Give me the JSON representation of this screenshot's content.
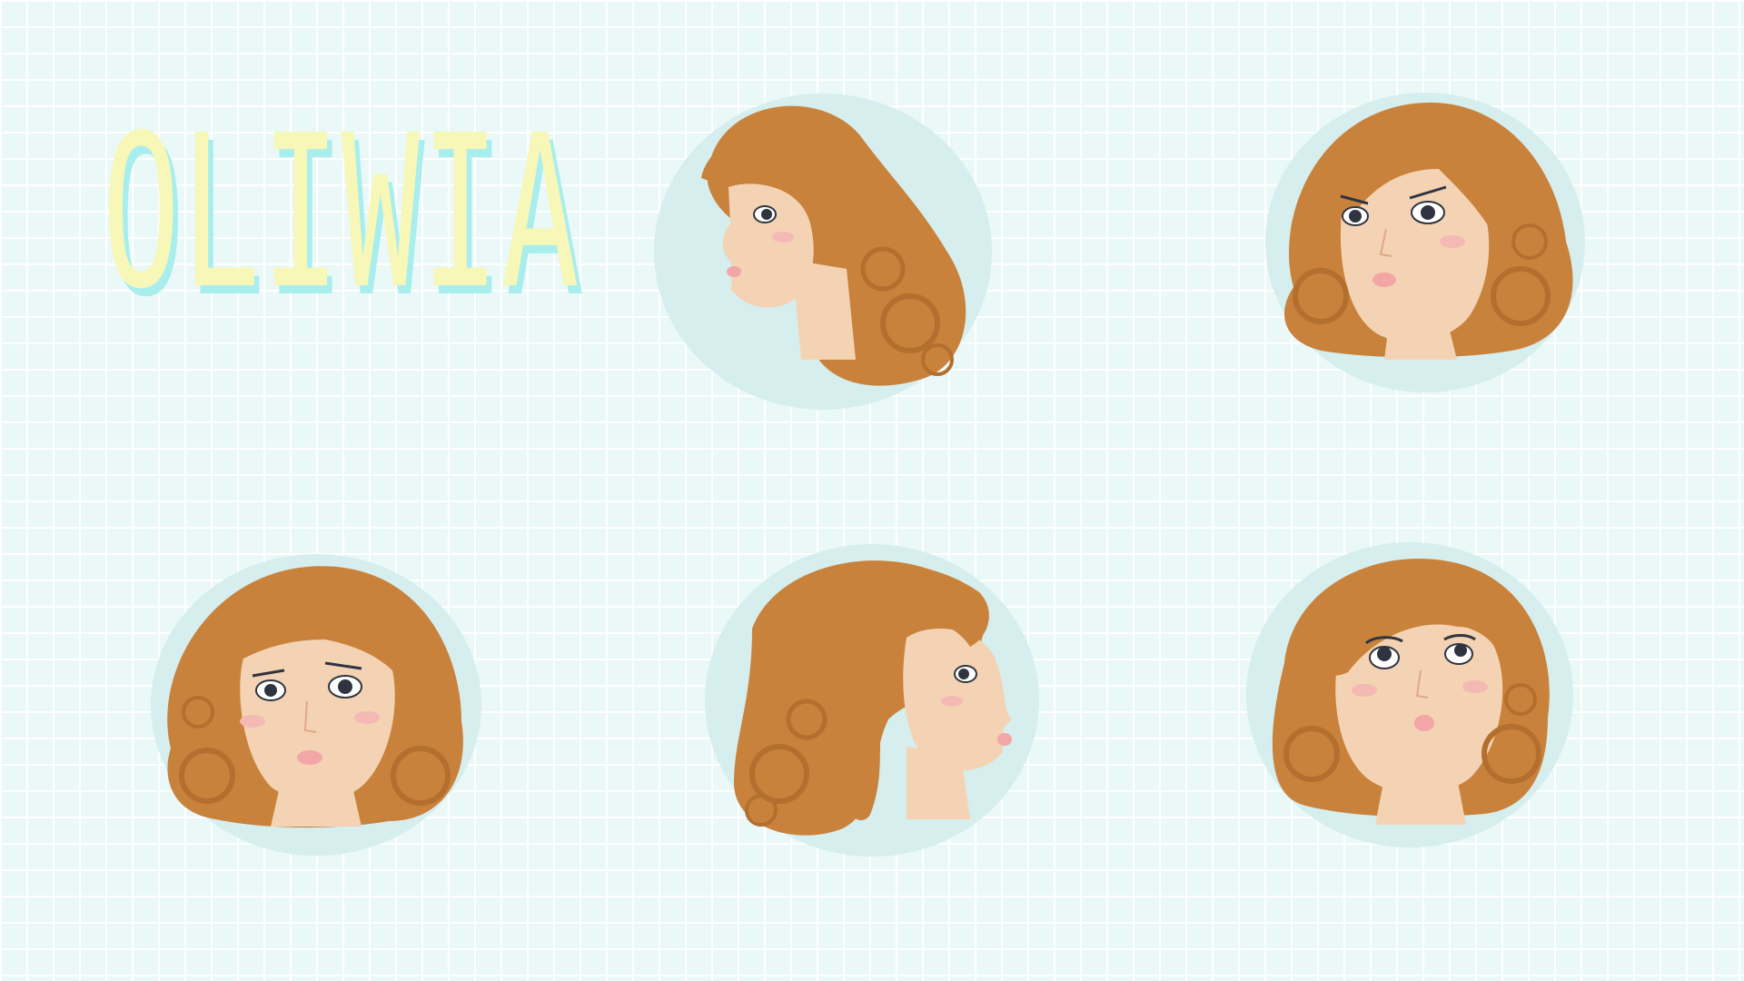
{
  "title": "OLIWIA",
  "colors": {
    "background": "#eaf8f8",
    "grid": "#ffffff",
    "title_fill": "#f7f7b8",
    "title_shadow": "#a8eeee",
    "circle": "#d6eeee",
    "hair": "#c9823c",
    "hair_dark": "#b36f2e",
    "skin": "#f3d3b3",
    "lips": "#f2a6a6",
    "blush": "#f4b9b4",
    "eye": "#2f3440"
  },
  "portraits": [
    {
      "pose": "profile-left",
      "icon": "portrait-profile-left-icon"
    },
    {
      "pose": "three-quarter-angry",
      "icon": "portrait-three-quarter-angry-icon"
    },
    {
      "pose": "front-frown",
      "icon": "portrait-front-frown-icon"
    },
    {
      "pose": "profile-right",
      "icon": "portrait-profile-right-icon"
    },
    {
      "pose": "three-quarter-looking-up",
      "icon": "portrait-looking-up-icon"
    }
  ]
}
